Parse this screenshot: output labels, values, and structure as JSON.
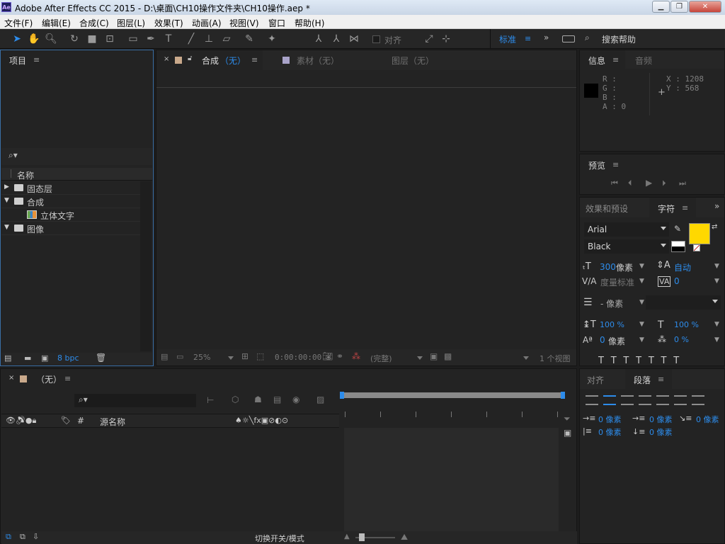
{
  "window": {
    "title": "Adobe After Effects CC 2015 - D:\\桌面\\CH10操作文件夹\\CH10操作.aep *",
    "logo": "Ae",
    "controls": [
      "minimize-icon",
      "maximize-icon",
      "close-icon"
    ]
  },
  "menu": [
    "文件(F)",
    "编辑(E)",
    "合成(C)",
    "图层(L)",
    "效果(T)",
    "动画(A)",
    "视图(V)",
    "窗口",
    "帮助(H)"
  ],
  "toolbar": {
    "align_label": "对齐",
    "workspace": "标准",
    "more": "»",
    "search_help": "搜索帮助"
  },
  "project": {
    "title": "项目",
    "search_placeholder": "",
    "column_name": "名称",
    "items": [
      {
        "label": "固态层",
        "type": "folder",
        "expanded": false
      },
      {
        "label": "合成",
        "type": "folder",
        "expanded": true
      },
      {
        "label": "立体文字",
        "type": "composition",
        "expanded": false
      },
      {
        "label": "图像",
        "type": "folder",
        "expanded": true
      }
    ],
    "bpc": "8 bpc"
  },
  "viewer": {
    "tabs": [
      {
        "label": "合成",
        "suffix": "（无）",
        "active": true
      },
      {
        "label": "素材",
        "suffix": "（无）",
        "active": false
      },
      {
        "label": "图层",
        "suffix": "（无）",
        "active": false
      }
    ],
    "zoom": "25%",
    "timecode": "0:00:00:00",
    "resolution": "(完整)",
    "views": "1 个视图"
  },
  "info": {
    "tabs": [
      "信息",
      "音频"
    ],
    "r": "R :",
    "g": "G :",
    "b": "B :",
    "a": "A : 0",
    "x": "X : 1208",
    "y": "Y : 568"
  },
  "preview": {
    "title": "预览"
  },
  "character": {
    "tabs": [
      "效果和预设",
      "字符"
    ],
    "font": "Arial",
    "style": "Black",
    "size": "300",
    "size_unit": "像素",
    "leading": "自动",
    "kerning": "度量标准",
    "tracking": "0",
    "stroke": "- 像素",
    "vscale": "100 %",
    "hscale": "100 %",
    "baseline": "0",
    "baseline_unit": "像素",
    "tsume": "0 %",
    "fill_color": "#ffd800"
  },
  "timeline": {
    "tab": "（无）",
    "col_source": "源名称",
    "col_hash": "#",
    "footer": "切换开关/模式"
  },
  "paragraph": {
    "tabs": [
      "对齐",
      "段落"
    ],
    "indent_left": "0 像素",
    "indent_first": "0 像素",
    "indent_right": "0 像素",
    "space_before": "0 像素",
    "space_after": "0 像素"
  }
}
